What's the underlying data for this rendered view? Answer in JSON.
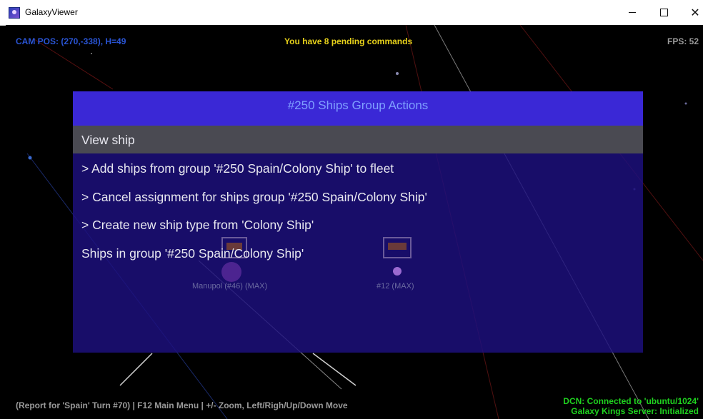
{
  "window": {
    "title": "GalaxyViewer"
  },
  "hud": {
    "cam_pos": "CAM POS: (270,-338), H=49",
    "pending": "You have 8 pending commands",
    "fps": "FPS: 52",
    "report": "(Report for 'Spain' Turn #70) | F12 Main Menu | +/- Zoom, Left/Righ/Up/Down Move",
    "dcn": "DCN: Connected to 'ubuntu/1024'",
    "server": "Galaxy Kings Server: Initialized"
  },
  "modal": {
    "title": "#250 Ships Group Actions",
    "items": [
      {
        "label": "View ship"
      },
      {
        "label": "> Add ships from group '#250 Spain/Colony Ship' to fleet"
      },
      {
        "label": "> Cancel assignment for ships group '#250 Spain/Colony Ship'"
      },
      {
        "label": "> Create new ship type from 'Colony Ship'"
      },
      {
        "label": "Ships in group '#250 Spain/Colony Ship'"
      }
    ]
  },
  "planets": [
    {
      "label": "Manupol (#46) (MAX)"
    },
    {
      "label": "#12 (MAX)"
    }
  ],
  "colors": {
    "modal_header": "#3a28d6",
    "modal_body": "#1d1080",
    "selected_row": "#4a4a52",
    "cam_pos": "#2a55d6",
    "pending": "#e8d21a",
    "status_green": "#1fd11f"
  }
}
